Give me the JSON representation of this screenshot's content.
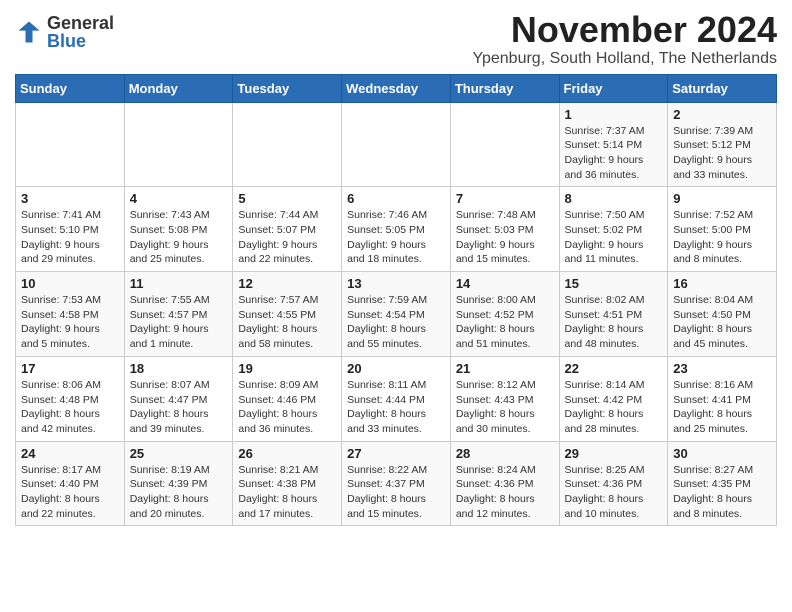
{
  "logo": {
    "general": "General",
    "blue": "Blue"
  },
  "title": "November 2024",
  "location": "Ypenburg, South Holland, The Netherlands",
  "days_of_week": [
    "Sunday",
    "Monday",
    "Tuesday",
    "Wednesday",
    "Thursday",
    "Friday",
    "Saturday"
  ],
  "weeks": [
    [
      {
        "day": "",
        "info": ""
      },
      {
        "day": "",
        "info": ""
      },
      {
        "day": "",
        "info": ""
      },
      {
        "day": "",
        "info": ""
      },
      {
        "day": "",
        "info": ""
      },
      {
        "day": "1",
        "info": "Sunrise: 7:37 AM\nSunset: 5:14 PM\nDaylight: 9 hours and 36 minutes."
      },
      {
        "day": "2",
        "info": "Sunrise: 7:39 AM\nSunset: 5:12 PM\nDaylight: 9 hours and 33 minutes."
      }
    ],
    [
      {
        "day": "3",
        "info": "Sunrise: 7:41 AM\nSunset: 5:10 PM\nDaylight: 9 hours and 29 minutes."
      },
      {
        "day": "4",
        "info": "Sunrise: 7:43 AM\nSunset: 5:08 PM\nDaylight: 9 hours and 25 minutes."
      },
      {
        "day": "5",
        "info": "Sunrise: 7:44 AM\nSunset: 5:07 PM\nDaylight: 9 hours and 22 minutes."
      },
      {
        "day": "6",
        "info": "Sunrise: 7:46 AM\nSunset: 5:05 PM\nDaylight: 9 hours and 18 minutes."
      },
      {
        "day": "7",
        "info": "Sunrise: 7:48 AM\nSunset: 5:03 PM\nDaylight: 9 hours and 15 minutes."
      },
      {
        "day": "8",
        "info": "Sunrise: 7:50 AM\nSunset: 5:02 PM\nDaylight: 9 hours and 11 minutes."
      },
      {
        "day": "9",
        "info": "Sunrise: 7:52 AM\nSunset: 5:00 PM\nDaylight: 9 hours and 8 minutes."
      }
    ],
    [
      {
        "day": "10",
        "info": "Sunrise: 7:53 AM\nSunset: 4:58 PM\nDaylight: 9 hours and 5 minutes."
      },
      {
        "day": "11",
        "info": "Sunrise: 7:55 AM\nSunset: 4:57 PM\nDaylight: 9 hours and 1 minute."
      },
      {
        "day": "12",
        "info": "Sunrise: 7:57 AM\nSunset: 4:55 PM\nDaylight: 8 hours and 58 minutes."
      },
      {
        "day": "13",
        "info": "Sunrise: 7:59 AM\nSunset: 4:54 PM\nDaylight: 8 hours and 55 minutes."
      },
      {
        "day": "14",
        "info": "Sunrise: 8:00 AM\nSunset: 4:52 PM\nDaylight: 8 hours and 51 minutes."
      },
      {
        "day": "15",
        "info": "Sunrise: 8:02 AM\nSunset: 4:51 PM\nDaylight: 8 hours and 48 minutes."
      },
      {
        "day": "16",
        "info": "Sunrise: 8:04 AM\nSunset: 4:50 PM\nDaylight: 8 hours and 45 minutes."
      }
    ],
    [
      {
        "day": "17",
        "info": "Sunrise: 8:06 AM\nSunset: 4:48 PM\nDaylight: 8 hours and 42 minutes."
      },
      {
        "day": "18",
        "info": "Sunrise: 8:07 AM\nSunset: 4:47 PM\nDaylight: 8 hours and 39 minutes."
      },
      {
        "day": "19",
        "info": "Sunrise: 8:09 AM\nSunset: 4:46 PM\nDaylight: 8 hours and 36 minutes."
      },
      {
        "day": "20",
        "info": "Sunrise: 8:11 AM\nSunset: 4:44 PM\nDaylight: 8 hours and 33 minutes."
      },
      {
        "day": "21",
        "info": "Sunrise: 8:12 AM\nSunset: 4:43 PM\nDaylight: 8 hours and 30 minutes."
      },
      {
        "day": "22",
        "info": "Sunrise: 8:14 AM\nSunset: 4:42 PM\nDaylight: 8 hours and 28 minutes."
      },
      {
        "day": "23",
        "info": "Sunrise: 8:16 AM\nSunset: 4:41 PM\nDaylight: 8 hours and 25 minutes."
      }
    ],
    [
      {
        "day": "24",
        "info": "Sunrise: 8:17 AM\nSunset: 4:40 PM\nDaylight: 8 hours and 22 minutes."
      },
      {
        "day": "25",
        "info": "Sunrise: 8:19 AM\nSunset: 4:39 PM\nDaylight: 8 hours and 20 minutes."
      },
      {
        "day": "26",
        "info": "Sunrise: 8:21 AM\nSunset: 4:38 PM\nDaylight: 8 hours and 17 minutes."
      },
      {
        "day": "27",
        "info": "Sunrise: 8:22 AM\nSunset: 4:37 PM\nDaylight: 8 hours and 15 minutes."
      },
      {
        "day": "28",
        "info": "Sunrise: 8:24 AM\nSunset: 4:36 PM\nDaylight: 8 hours and 12 minutes."
      },
      {
        "day": "29",
        "info": "Sunrise: 8:25 AM\nSunset: 4:36 PM\nDaylight: 8 hours and 10 minutes."
      },
      {
        "day": "30",
        "info": "Sunrise: 8:27 AM\nSunset: 4:35 PM\nDaylight: 8 hours and 8 minutes."
      }
    ]
  ]
}
